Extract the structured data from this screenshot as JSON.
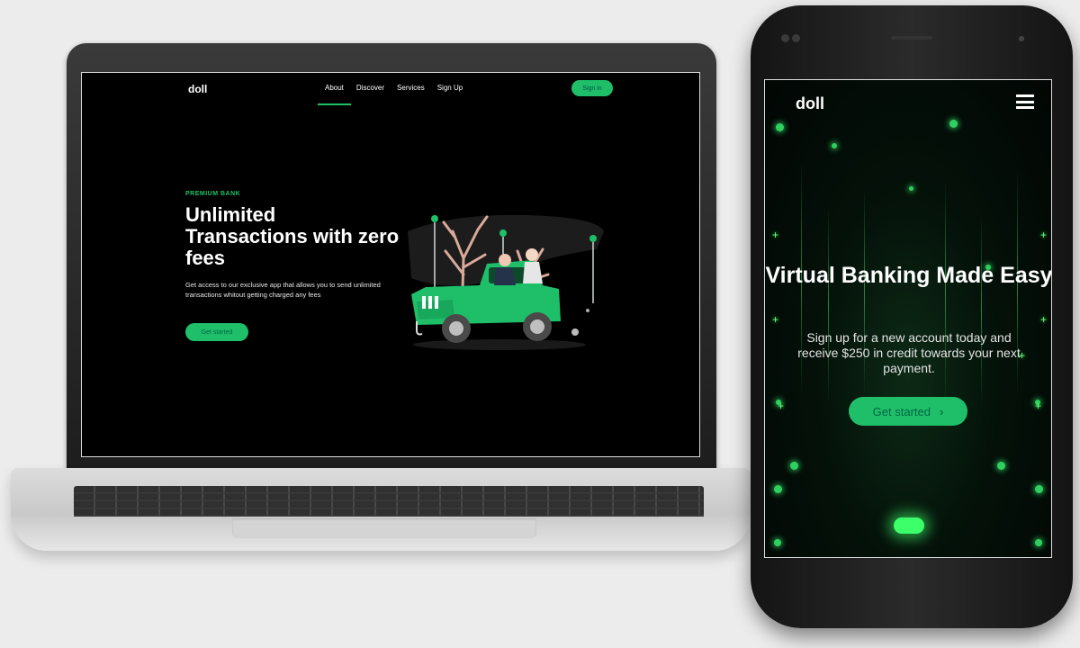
{
  "colors": {
    "accent": "#1fbf6a",
    "background": "#000000",
    "page_bg": "#ececec"
  },
  "laptop_site": {
    "brand": "doll",
    "nav": [
      {
        "label": "About",
        "active": true
      },
      {
        "label": "Discover",
        "active": false
      },
      {
        "label": "Services",
        "active": false
      },
      {
        "label": "Sign Up",
        "active": false
      }
    ],
    "signin_label": "Sign in",
    "hero": {
      "eyebrow": "PREMIUM BANK",
      "title": "Unlimited Transactions with zero fees",
      "description": "Get access to our exclusive app that allows you to send unlimited transactions whitout getting charged any fees",
      "cta_label": "Get started"
    }
  },
  "mobile_site": {
    "brand": "doll",
    "menu_icon": "hamburger-icon",
    "hero": {
      "title": "Virtual Banking Made Easy",
      "description": "Sign up for a new account today and receive $250 in credit towards your next payment.",
      "cta_label": "Get started",
      "cta_icon": "chevron-right-icon"
    }
  }
}
